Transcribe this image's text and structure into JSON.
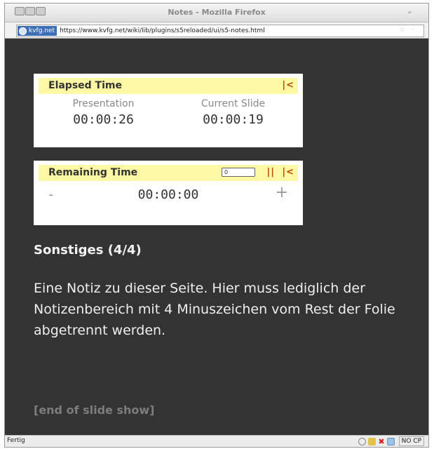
{
  "window": {
    "title": "Notes - Mozilla Firefox",
    "menu_glyph": "⌄"
  },
  "urlbar": {
    "site_badge": "kvfg.net",
    "url": "https://www.kvfg.net/wiki/lib/plugins/s5reloaded/ui/s5-notes.html"
  },
  "elapsed": {
    "heading": "Elapsed Time",
    "reset_label": "|<",
    "presentation_label": "Presentation",
    "presentation_value": "00:00:26",
    "slide_label": "Current Slide",
    "slide_value": "00:00:19"
  },
  "remaining": {
    "heading": "Remaining Time",
    "minutes_input_value": "0",
    "pause_label": "||",
    "reset_label": "|<",
    "minus_label": "-",
    "value": "00:00:00",
    "plus_label": "+"
  },
  "slide": {
    "title": "Sonstiges (4/4)",
    "note": "Eine Notiz zu dieser Seite. Hier muss lediglich der Notizenbereich mit 4 Minuszeichen vom Rest der Folie abgetrennt werden.",
    "end": "[end of slide show]"
  },
  "statusbar": {
    "status": "Fertig",
    "nocp": "NO CP"
  },
  "colors": {
    "background": "#333333",
    "panel_header": "#fdf8a3",
    "control_accent": "#b84a00"
  }
}
